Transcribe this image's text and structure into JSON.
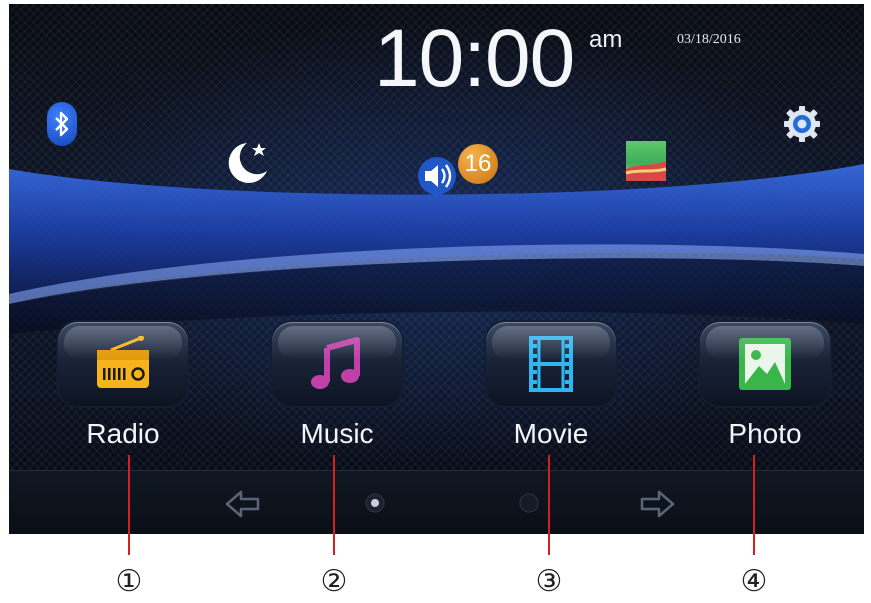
{
  "status": {
    "time": "10:00",
    "ampm": "am",
    "date": "03/18/2016",
    "volume_level": "16"
  },
  "status_icons": [
    "bluetooth-icon",
    "night-mode-icon",
    "volume-icon",
    "wallpaper-icon",
    "settings-icon"
  ],
  "apps": [
    {
      "label": "Radio",
      "icon": "radio-icon"
    },
    {
      "label": "Music",
      "icon": "music-icon"
    },
    {
      "label": "Movie",
      "icon": "movie-icon"
    },
    {
      "label": "Photo",
      "icon": "photo-icon"
    }
  ],
  "navigation": {
    "icons": [
      "arrow-left-icon",
      "arrow-right-icon"
    ],
    "page_count": 2,
    "current_page": 1
  },
  "callouts": [
    "①",
    "②",
    "③",
    "④"
  ],
  "colors": {
    "accent_blue": "#1e50c8",
    "badge_orange": "#e08a1e",
    "callout_red": "#d42020",
    "radio_yellow": "#f6b31c",
    "music_magenta": "#c040a8",
    "movie_cyan": "#2fb6f0",
    "photo_green": "#39b54a"
  }
}
